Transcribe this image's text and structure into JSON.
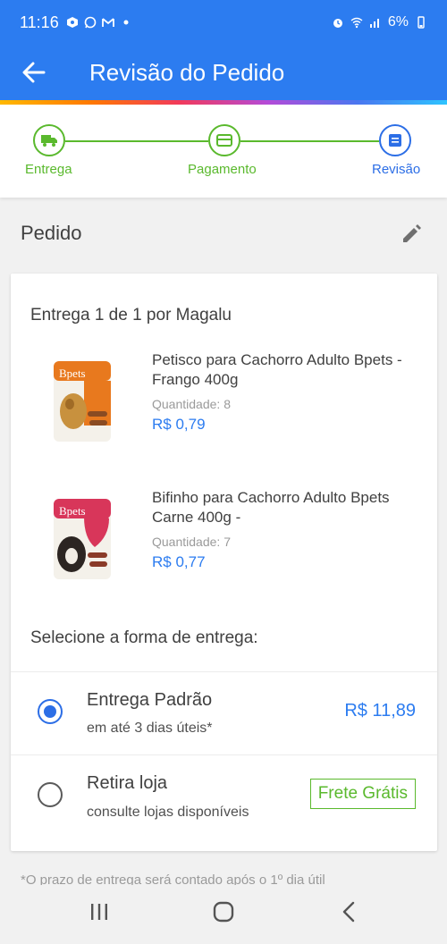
{
  "status_bar": {
    "time": "11:16",
    "battery": "6%"
  },
  "app_bar": {
    "title": "Revisão do Pedido",
    "back_icon": "arrow-left-icon"
  },
  "stepper": {
    "steps": [
      {
        "label": "Entrega",
        "icon": "truck-icon",
        "state": "done"
      },
      {
        "label": "Pagamento",
        "icon": "card-icon",
        "state": "done"
      },
      {
        "label": "Revisão",
        "icon": "receipt-icon",
        "state": "active"
      }
    ]
  },
  "order": {
    "section_title": "Pedido",
    "edit_icon": "pencil-icon",
    "delivery_heading": "Entrega 1 de 1 por Magalu",
    "products": [
      {
        "name": "Petisco para Cachorro Adulto Bpets - Frango 400g",
        "quantity_label": "Quantidade:",
        "quantity": "8",
        "price": "R$ 0,79",
        "package_color": "#e8791e"
      },
      {
        "name": "Bifinho para Cachorro Adulto Bpets Carne 400g -",
        "quantity_label": "Quantidade:",
        "quantity": "7",
        "price": "R$ 0,77",
        "package_color": "#d8365a"
      }
    ],
    "shipping_heading": "Selecione a forma de entrega:",
    "shipping_options": [
      {
        "name": "Entrega Padrão",
        "subtitle": "em até 3 dias úteis*",
        "price": "R$ 11,89",
        "selected": true
      },
      {
        "name": "Retira loja",
        "subtitle": "consulte lojas disponíveis",
        "badge": "Frete Grátis",
        "selected": false
      }
    ],
    "footnote": "*O prazo de entrega será contado após o 1º dia útil"
  },
  "colors": {
    "primary": "#2c7cf0",
    "success": "#5ab92d",
    "active_step": "#2c6ee6"
  }
}
